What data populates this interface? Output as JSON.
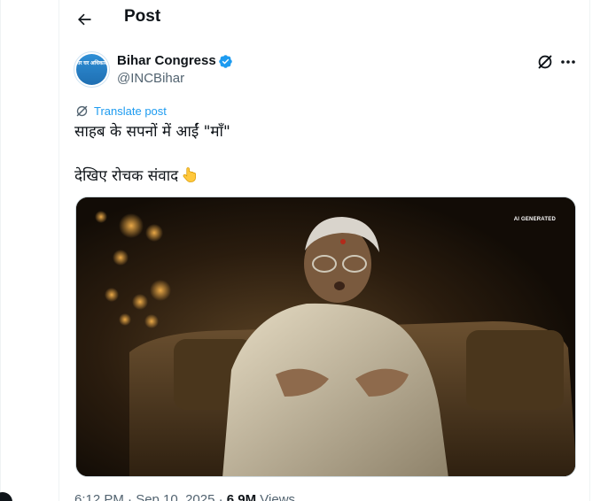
{
  "header": {
    "title": "Post"
  },
  "author": {
    "name": "Bihar Congress",
    "handle": "@INCBihar",
    "avatar_text": "घर घर अधिकार",
    "verified_color": "#1d9bf0"
  },
  "actions": {
    "grok_icon": "grok-icon",
    "more_icon": "more-icon"
  },
  "translate": {
    "label": "Translate post"
  },
  "tweet": {
    "line1": "साहब के सपनों में आईं \"माँ\"",
    "line2": "देखिए रोचक संवाद",
    "emoji": "backhand-index-pointing-down"
  },
  "media": {
    "badge": "AI GENERATED"
  },
  "meta": {
    "time": "6:12 PM · Sep 10, 2025 · ",
    "views_count": "6.9M",
    "views_label": " Views"
  },
  "colors": {
    "accent": "#1d9bf0",
    "text": "#0f1419",
    "secondary": "#536471"
  }
}
